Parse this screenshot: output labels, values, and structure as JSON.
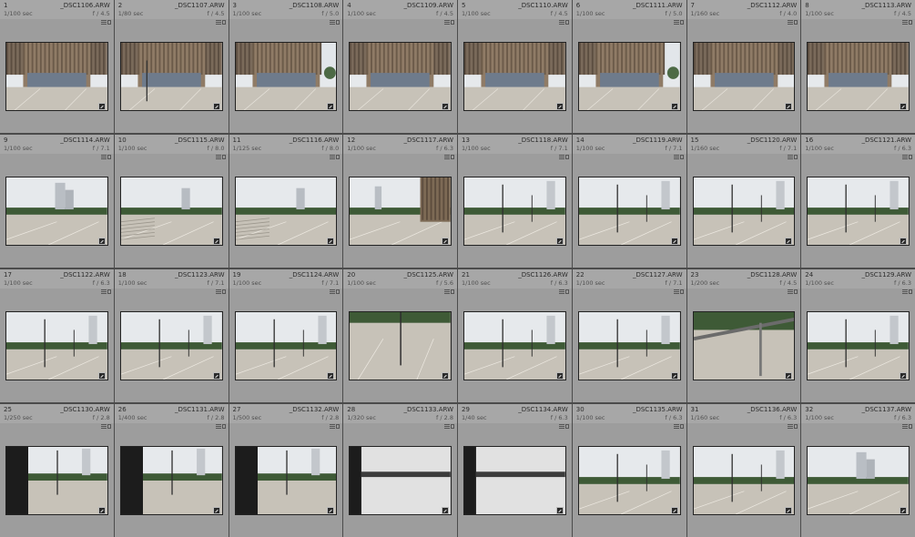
{
  "grid": {
    "items": [
      {
        "index": "1",
        "filename": "_DSC1106.ARW",
        "shutter": "1/100 sec",
        "aperture": "f / 4.5",
        "scene": "building-left"
      },
      {
        "index": "2",
        "filename": "_DSC1107.ARW",
        "shutter": "1/80 sec",
        "aperture": "f / 4.5",
        "scene": "building-pole"
      },
      {
        "index": "3",
        "filename": "_DSC1108.ARW",
        "shutter": "1/100 sec",
        "aperture": "f / 5.0",
        "scene": "building-tree"
      },
      {
        "index": "4",
        "filename": "_DSC1109.ARW",
        "shutter": "1/100 sec",
        "aperture": "f / 4.5",
        "scene": "building-center"
      },
      {
        "index": "5",
        "filename": "_DSC1110.ARW",
        "shutter": "1/100 sec",
        "aperture": "f / 4.5",
        "scene": "building-center"
      },
      {
        "index": "6",
        "filename": "_DSC1111.ARW",
        "shutter": "1/100 sec",
        "aperture": "f / 5.0",
        "scene": "building-tree"
      },
      {
        "index": "7",
        "filename": "_DSC1112.ARW",
        "shutter": "1/160 sec",
        "aperture": "f / 4.0",
        "scene": "building-center"
      },
      {
        "index": "8",
        "filename": "_DSC1113.ARW",
        "shutter": "1/100 sec",
        "aperture": "f / 4.5",
        "scene": "building-center"
      },
      {
        "index": "9",
        "filename": "_DSC1114.ARW",
        "shutter": "1/100 sec",
        "aperture": "f / 7.1",
        "scene": "plaza-tower"
      },
      {
        "index": "10",
        "filename": "_DSC1115.ARW",
        "shutter": "1/100 sec",
        "aperture": "f / 8.0",
        "scene": "plaza-steps"
      },
      {
        "index": "11",
        "filename": "_DSC1116.ARW",
        "shutter": "1/125 sec",
        "aperture": "f / 8.0",
        "scene": "plaza-steps"
      },
      {
        "index": "12",
        "filename": "_DSC1117.ARW",
        "shutter": "1/100 sec",
        "aperture": "f / 6.3",
        "scene": "plaza-building-right"
      },
      {
        "index": "13",
        "filename": "_DSC1118.ARW",
        "shutter": "1/100 sec",
        "aperture": "f / 7.1",
        "scene": "plaza-poles"
      },
      {
        "index": "14",
        "filename": "_DSC1119.ARW",
        "shutter": "1/100 sec",
        "aperture": "f / 7.1",
        "scene": "plaza-poles"
      },
      {
        "index": "15",
        "filename": "_DSC1120.ARW",
        "shutter": "1/160 sec",
        "aperture": "f / 7.1",
        "scene": "plaza-poles"
      },
      {
        "index": "16",
        "filename": "_DSC1121.ARW",
        "shutter": "1/100 sec",
        "aperture": "f / 6.3",
        "scene": "plaza-poles"
      },
      {
        "index": "17",
        "filename": "_DSC1122.ARW",
        "shutter": "1/100 sec",
        "aperture": "f / 6.3",
        "scene": "plaza-poles"
      },
      {
        "index": "18",
        "filename": "_DSC1123.ARW",
        "shutter": "1/100 sec",
        "aperture": "f / 7.1",
        "scene": "plaza-poles"
      },
      {
        "index": "19",
        "filename": "_DSC1124.ARW",
        "shutter": "1/100 sec",
        "aperture": "f / 7.1",
        "scene": "plaza-poles"
      },
      {
        "index": "20",
        "filename": "_DSC1125.ARW",
        "shutter": "1/100 sec",
        "aperture": "f / 5.6",
        "scene": "pavement-low"
      },
      {
        "index": "21",
        "filename": "_DSC1126.ARW",
        "shutter": "1/100 sec",
        "aperture": "f / 6.3",
        "scene": "plaza-poles"
      },
      {
        "index": "22",
        "filename": "_DSC1127.ARW",
        "shutter": "1/100 sec",
        "aperture": "f / 7.1",
        "scene": "plaza-poles"
      },
      {
        "index": "23",
        "filename": "_DSC1128.ARW",
        "shutter": "1/200 sec",
        "aperture": "f / 4.5",
        "scene": "railing"
      },
      {
        "index": "24",
        "filename": "_DSC1129.ARW",
        "shutter": "1/100 sec",
        "aperture": "f / 6.3",
        "scene": "plaza-poles"
      },
      {
        "index": "25",
        "filename": "_DSC1130.ARW",
        "shutter": "1/250 sec",
        "aperture": "f / 2.8",
        "scene": "blur-pole"
      },
      {
        "index": "26",
        "filename": "_DSC1131.ARW",
        "shutter": "1/400 sec",
        "aperture": "f / 2.8",
        "scene": "blur-pole"
      },
      {
        "index": "27",
        "filename": "_DSC1132.ARW",
        "shutter": "1/500 sec",
        "aperture": "f / 2.8",
        "scene": "blur-pole"
      },
      {
        "index": "28",
        "filename": "_DSC1133.ARW",
        "shutter": "1/320 sec",
        "aperture": "f / 2.8",
        "scene": "blur-white"
      },
      {
        "index": "29",
        "filename": "_DSC1134.ARW",
        "shutter": "1/40 sec",
        "aperture": "f / 6.3",
        "scene": "blur-white"
      },
      {
        "index": "30",
        "filename": "_DSC1135.ARW",
        "shutter": "1/100 sec",
        "aperture": "f / 6.3",
        "scene": "plaza-poles"
      },
      {
        "index": "31",
        "filename": "_DSC1136.ARW",
        "shutter": "1/160 sec",
        "aperture": "f / 6.3",
        "scene": "plaza-poles"
      },
      {
        "index": "32",
        "filename": "_DSC1137.ARW",
        "shutter": "1/100 sec",
        "aperture": "f / 6.3",
        "scene": "plaza-tower"
      }
    ]
  },
  "colors": {
    "cell_bg": "#9d9d9d",
    "header_bg": "#a7a7a7",
    "grid_gap": "#4b4b4b",
    "sky": "#e6e9ec",
    "ground": "#c7c2b8",
    "hedge": "#3e5a36",
    "building": "#7a6a5a"
  }
}
